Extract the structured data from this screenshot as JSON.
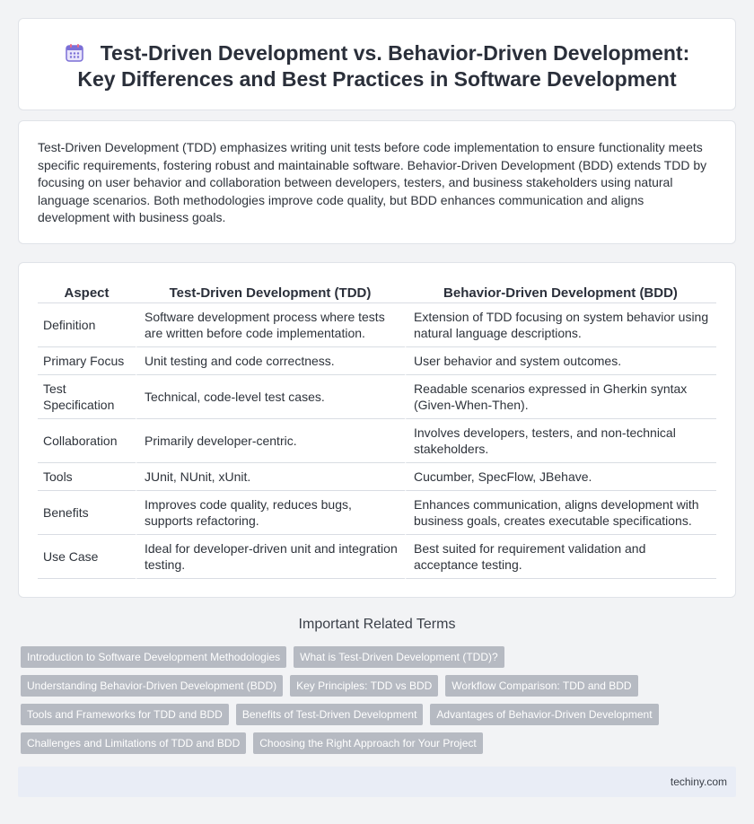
{
  "header": {
    "title": "Test-Driven Development vs. Behavior-Driven Development: Key Differences and Best Practices in Software Development",
    "icon": "calendar-icon"
  },
  "summary": "Test-Driven Development (TDD) emphasizes writing unit tests before code implementation to ensure functionality meets specific requirements, fostering robust and maintainable software. Behavior-Driven Development (BDD) extends TDD by focusing on user behavior and collaboration between developers, testers, and business stakeholders using natural language scenarios. Both methodologies improve code quality, but BDD enhances communication and aligns development with business goals.",
  "table": {
    "headers": [
      "Aspect",
      "Test-Driven Development (TDD)",
      "Behavior-Driven Development (BDD)"
    ],
    "rows": [
      [
        "Definition",
        "Software development process where tests are written before code implementation.",
        "Extension of TDD focusing on system behavior using natural language descriptions."
      ],
      [
        "Primary Focus",
        "Unit testing and code correctness.",
        "User behavior and system outcomes."
      ],
      [
        "Test Specification",
        "Technical, code-level test cases.",
        "Readable scenarios expressed in Gherkin syntax (Given-When-Then)."
      ],
      [
        "Collaboration",
        "Primarily developer-centric.",
        "Involves developers, testers, and non-technical stakeholders."
      ],
      [
        "Tools",
        "JUnit, NUnit, xUnit.",
        "Cucumber, SpecFlow, JBehave."
      ],
      [
        "Benefits",
        "Improves code quality, reduces bugs, supports refactoring.",
        "Enhances communication, aligns development with business goals, creates executable specifications."
      ],
      [
        "Use Case",
        "Ideal for developer-driven unit and integration testing.",
        "Best suited for requirement validation and acceptance testing."
      ]
    ]
  },
  "related": {
    "title": "Important Related Terms",
    "tags": [
      [
        "Introduction to Software Development Methodologies",
        "What is Test-Driven Development (TDD)?"
      ],
      [
        "Understanding Behavior-Driven Development (BDD)",
        "Key Principles: TDD vs BDD",
        "Workflow Comparison: TDD and BDD"
      ],
      [
        "Tools and Frameworks for TDD and BDD",
        "Benefits of Test-Driven Development",
        "Advantages of Behavior-Driven Development"
      ],
      [
        "Challenges and Limitations of TDD and BDD",
        "Choosing the Right Approach for Your Project"
      ]
    ]
  },
  "footer": {
    "site": "techiny.com"
  },
  "colors": {
    "accent_icon": "#7b6fd6",
    "tag_bg": "#b6bac2",
    "footer_bg": "#e9edf6"
  }
}
